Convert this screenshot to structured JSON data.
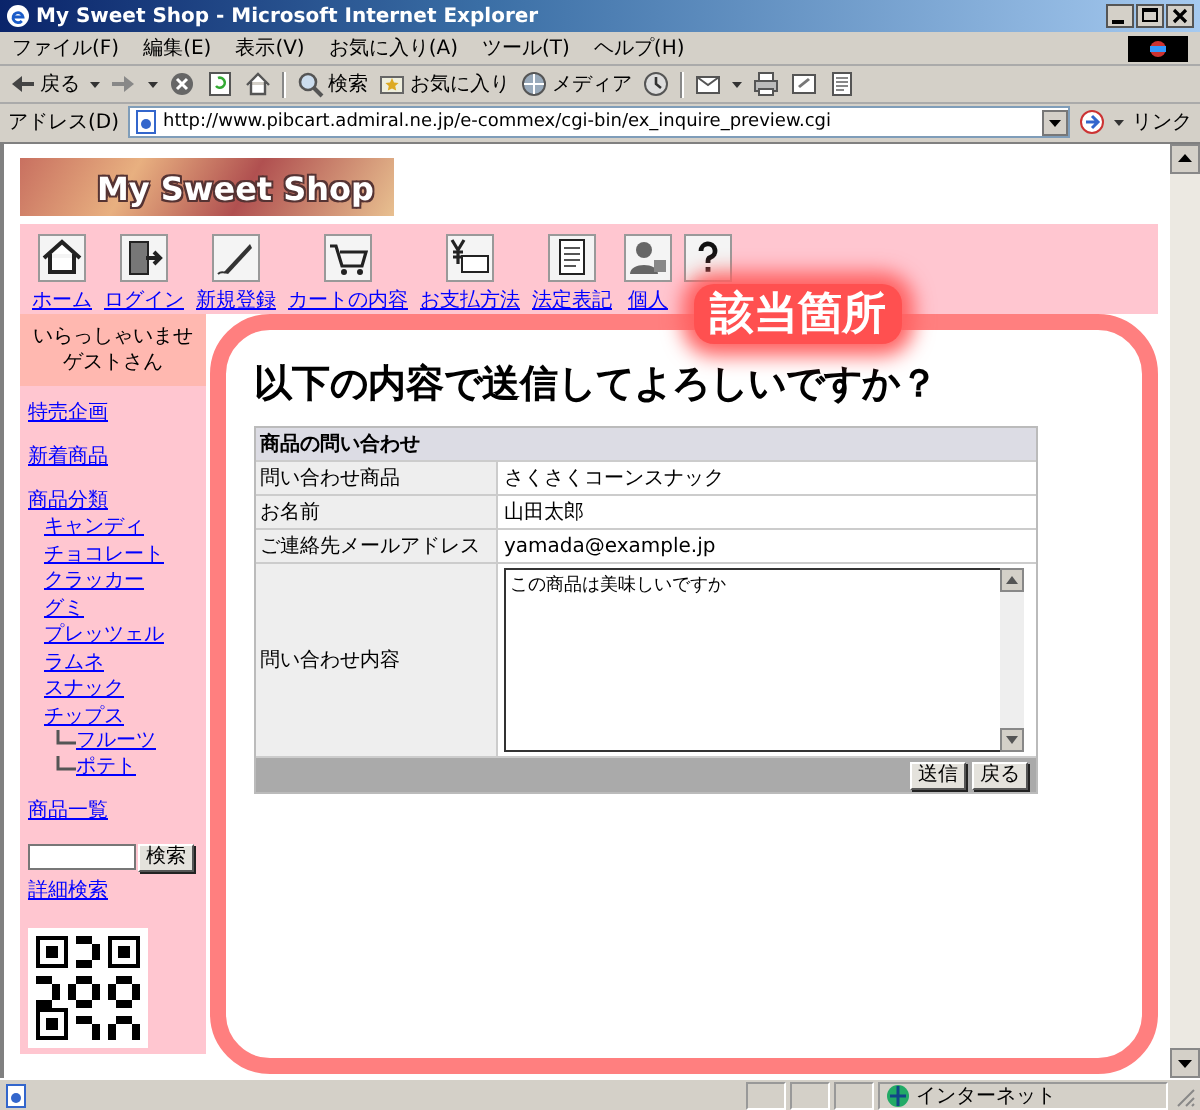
{
  "window": {
    "title": "My Sweet Shop - Microsoft Internet Explorer"
  },
  "menu": [
    "ファイル(F)",
    "編集(E)",
    "表示(V)",
    "お気に入り(A)",
    "ツール(T)",
    "ヘルプ(H)"
  ],
  "toolbar": [
    {
      "kind": "button",
      "label": "戻る",
      "caret": true
    },
    {
      "kind": "icon",
      "caret": true
    },
    {
      "kind": "icon",
      "caret": false
    },
    {
      "kind": "icon",
      "caret": false
    },
    {
      "kind": "icon",
      "caret": false
    },
    {
      "kind": "separator"
    },
    {
      "kind": "button",
      "label": "検索",
      "caret": false
    },
    {
      "kind": "button",
      "label": "お気に入り",
      "caret": false
    },
    {
      "kind": "button",
      "label": "メディア",
      "caret": false
    },
    {
      "kind": "icon",
      "caret": false
    },
    {
      "kind": "separator"
    },
    {
      "kind": "icon",
      "caret": true
    },
    {
      "kind": "icon",
      "caret": false
    },
    {
      "kind": "icon",
      "caret": false
    },
    {
      "kind": "icon",
      "caret": false
    }
  ],
  "address_bar": {
    "label": "アドレス(D)",
    "value": "http://www.pibcart.admiral.ne.jp/e-commex/cgi-bin/ex_inquire_preview.cgi",
    "links": "リンク"
  },
  "page": {
    "logo": "My Sweet Shop",
    "nav": [
      {
        "kind": "link",
        "label": "ホーム"
      },
      {
        "kind": "link",
        "label": "ログイン"
      },
      {
        "kind": "link",
        "label": "新規登録"
      },
      {
        "kind": "link",
        "label": "カートの内容"
      },
      {
        "kind": "link",
        "label": "お支払方法"
      },
      {
        "kind": "link",
        "label": "法定表記"
      },
      {
        "kind": "link",
        "label": "個人"
      },
      {
        "kind": "icon"
      }
    ],
    "greeting": [
      "いらっしゃいませ",
      "ゲストさん"
    ],
    "sidebar": [
      {
        "label": "特売企画"
      },
      {
        "label": "新着商品"
      },
      {
        "label": "商品分類",
        "children": [
          {
            "label": "キャンディ"
          },
          {
            "label": "チョコレート"
          },
          {
            "label": "クラッカー"
          },
          {
            "label": "グミ"
          },
          {
            "label": "プレッツェル"
          },
          {
            "label": "ラムネ"
          },
          {
            "label": "スナック"
          },
          {
            "label": "チップス",
            "children": [
              {
                "label": "フルーツ"
              },
              {
                "label": "ポテト"
              }
            ]
          }
        ]
      },
      {
        "label": "商品一覧"
      }
    ],
    "search": {
      "button": "検索",
      "advanced": "詳細検索"
    },
    "heading": "以下の内容で送信してよろしいですか？",
    "form": {
      "title": "商品の問い合わせ",
      "rows": [
        {
          "label": "問い合わせ商品",
          "value": "さくさくコーンスナック",
          "kind": "text"
        },
        {
          "label": "お名前",
          "value": "山田太郎",
          "kind": "text"
        },
        {
          "label": "ご連絡先メールアドレス",
          "value": "yamada@example.jp",
          "kind": "text"
        },
        {
          "label": "問い合わせ内容",
          "value": "この商品は美味しいですか",
          "kind": "textarea"
        }
      ],
      "buttons": [
        "送信",
        "戻る"
      ]
    }
  },
  "annotation": {
    "label": "該当箇所"
  },
  "status_bar": {
    "zone": "インターネット"
  }
}
